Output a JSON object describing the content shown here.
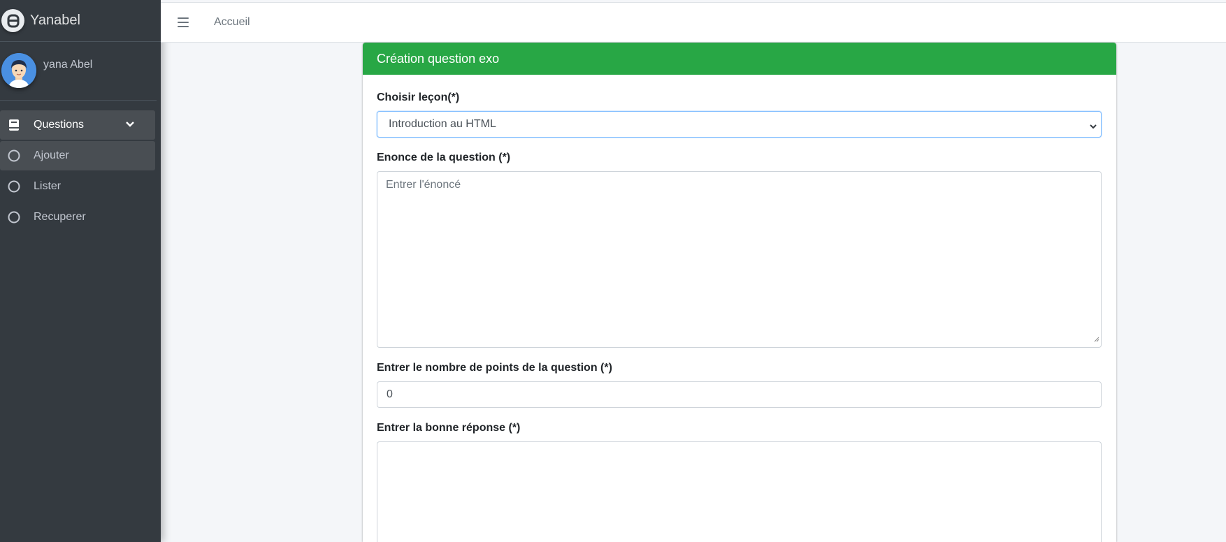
{
  "app": {
    "brand": "Yanabel"
  },
  "user": {
    "name": "yana Abel"
  },
  "sidebar": {
    "items": [
      {
        "label": "Questions",
        "icon": "book-icon"
      },
      {
        "label": "Ajouter",
        "icon": "circle-icon"
      },
      {
        "label": "Lister",
        "icon": "circle-icon"
      },
      {
        "label": "Recuperer",
        "icon": "circle-icon"
      }
    ]
  },
  "topbar": {
    "breadcrumb": "Accueil"
  },
  "card": {
    "title": "Création question exo",
    "lesson_label": "Choisir leçon(*)",
    "lesson_value": "Introduction au HTML",
    "statement_label": "Enonce de la question (*)",
    "statement_placeholder": "Entrer l'énoncé",
    "points_label": "Entrer le nombre de points de la question (*)",
    "points_value": "0",
    "answer_label": "Entrer la bonne réponse (*)"
  },
  "colors": {
    "sidebar": "#343a40",
    "header": "#28a745",
    "focus": "#80bdff"
  }
}
